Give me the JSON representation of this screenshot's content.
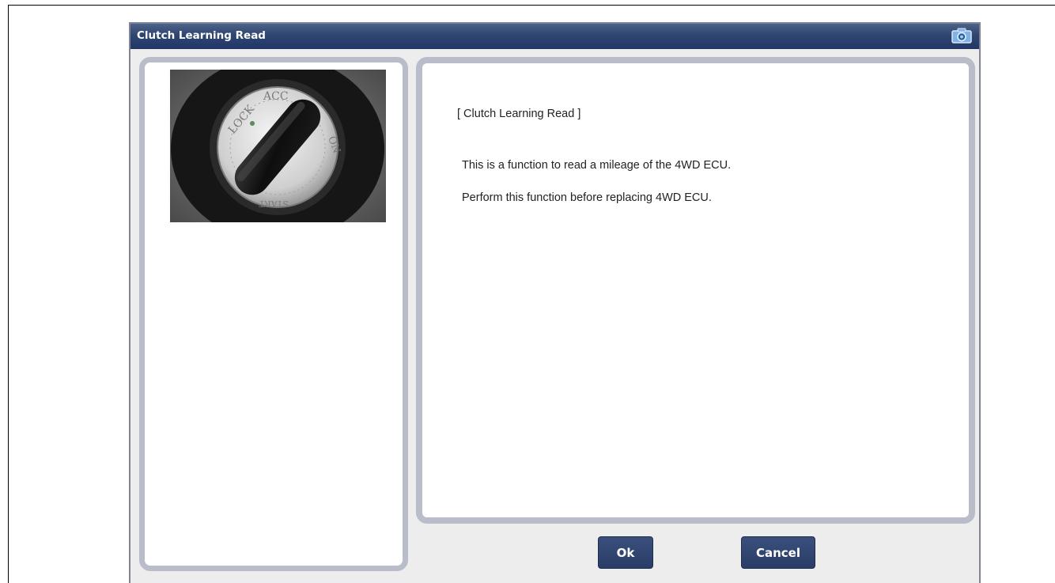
{
  "window": {
    "title": "Clutch Learning Read"
  },
  "content": {
    "heading": "[ Clutch Learning Read ]",
    "line1": "This is a function to read a mileage of the 4WD ECU.",
    "line2": "Perform this function before replacing 4WD ECU."
  },
  "buttons": {
    "ok_label": "Ok",
    "cancel_label": "Cancel"
  },
  "image": {
    "description_icon": "ignition-key-switch-photo",
    "switch_labels": [
      "LOCK",
      "ACC",
      "ON",
      "START"
    ]
  },
  "colors": {
    "titlebar": "#2f4571",
    "panel_border": "#b9bdc9",
    "button_bg": "#2a3d68",
    "window_bg": "#ededee"
  }
}
